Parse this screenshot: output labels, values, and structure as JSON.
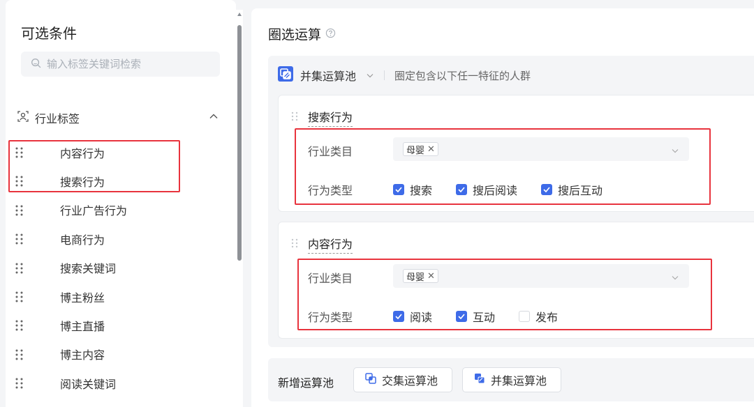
{
  "left_panel": {
    "title": "可选条件",
    "search_placeholder": "输入标签关键词检索",
    "group_label": "行业标签",
    "items": [
      {
        "label": "内容行为"
      },
      {
        "label": "搜索行为"
      },
      {
        "label": "行业广告行为"
      },
      {
        "label": "电商行为"
      },
      {
        "label": "搜索关键词"
      },
      {
        "label": "博主粉丝"
      },
      {
        "label": "博主直播"
      },
      {
        "label": "博主内容"
      },
      {
        "label": "阅读关键词"
      }
    ]
  },
  "right_panel": {
    "title": "圈选运算",
    "pool": {
      "name": "并集运算池",
      "description": "圈定包含以下任一特征的人群",
      "accent": "#3e6be8"
    },
    "cards": [
      {
        "title": "搜索行为",
        "category_label": "行业类目",
        "category_chip": "母婴",
        "behavior_label": "行为类型",
        "checks": [
          {
            "label": "搜索",
            "checked": true
          },
          {
            "label": "搜后阅读",
            "checked": true
          },
          {
            "label": "搜后互动",
            "checked": true
          }
        ]
      },
      {
        "title": "内容行为",
        "category_label": "行业类目",
        "category_chip": "母婴",
        "behavior_label": "行为类型",
        "checks": [
          {
            "label": "阅读",
            "checked": true
          },
          {
            "label": "互动",
            "checked": true
          },
          {
            "label": "发布",
            "checked": false
          }
        ]
      }
    ],
    "add_bar": {
      "label": "新增运算池",
      "intersection_button": "交集运算池",
      "union_button": "并集运算池"
    }
  },
  "highlight_color": "#e8333d"
}
